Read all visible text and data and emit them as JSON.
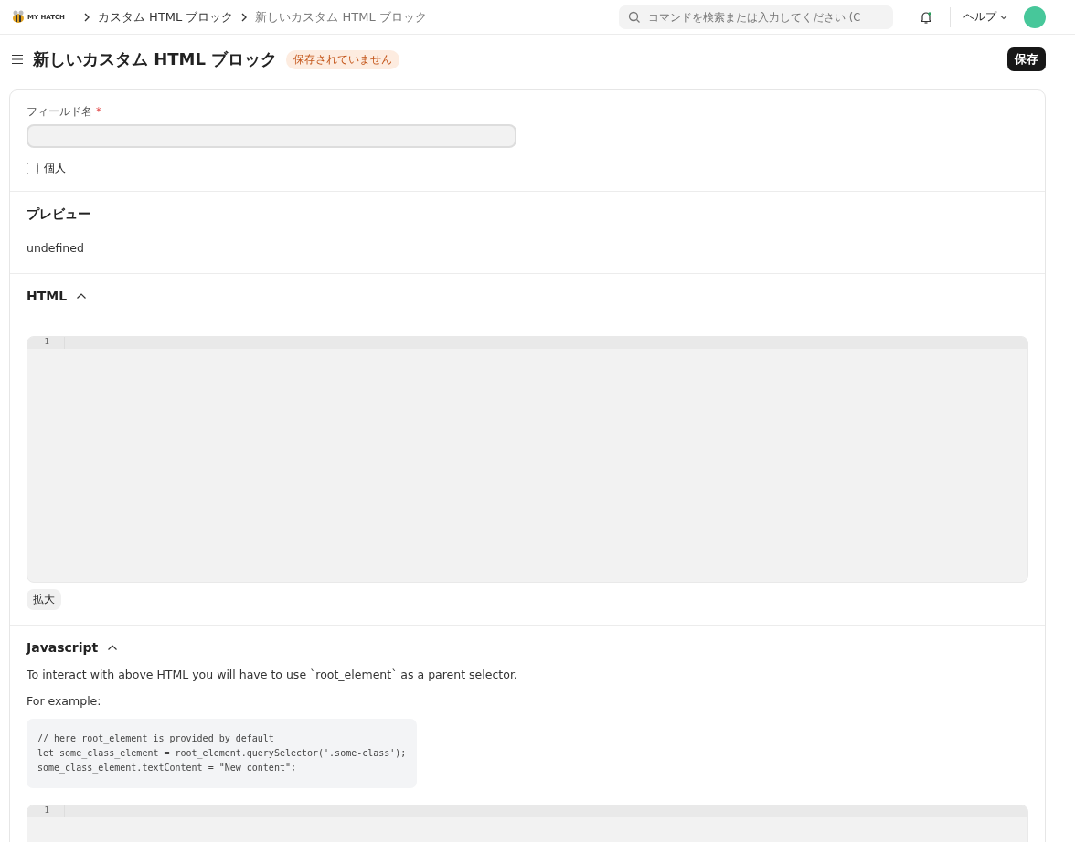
{
  "logo": {
    "text": "MY HATCH"
  },
  "breadcrumbs": [
    {
      "label": "カスタム HTML ブロック",
      "current": false
    },
    {
      "label": "新しいカスタム HTML ブロック",
      "current": true
    }
  ],
  "search": {
    "placeholder": "コマンドを検索または入力してください (C"
  },
  "notifications": {
    "unread": true
  },
  "help_menu": {
    "label": "ヘルプ"
  },
  "page": {
    "title": "新しいカスタム HTML ブロック",
    "status": "保存されていません",
    "save_button": "保存"
  },
  "form": {
    "field_name": {
      "label": "フィールド名",
      "required_mark": "*"
    },
    "private_checkbox": {
      "label": "個人",
      "checked": false
    },
    "preview": {
      "heading": "プレビュー",
      "content": "undefined"
    },
    "html_section": {
      "heading": "HTML",
      "expanded": true,
      "line_numbers": [
        "1"
      ],
      "expand_button": "拡大"
    },
    "javascript_section": {
      "heading": "Javascript",
      "expanded": true,
      "description": "To interact with above HTML you will have to use `root_element` as a parent selector.",
      "example_label": "For example:",
      "example_code": [
        "// here root_element is provided by default",
        "let some_class_element = root_element.querySelector('.some-class');",
        "some_class_element.textContent = \"New content\";"
      ],
      "line_numbers": [
        "1"
      ]
    }
  }
}
